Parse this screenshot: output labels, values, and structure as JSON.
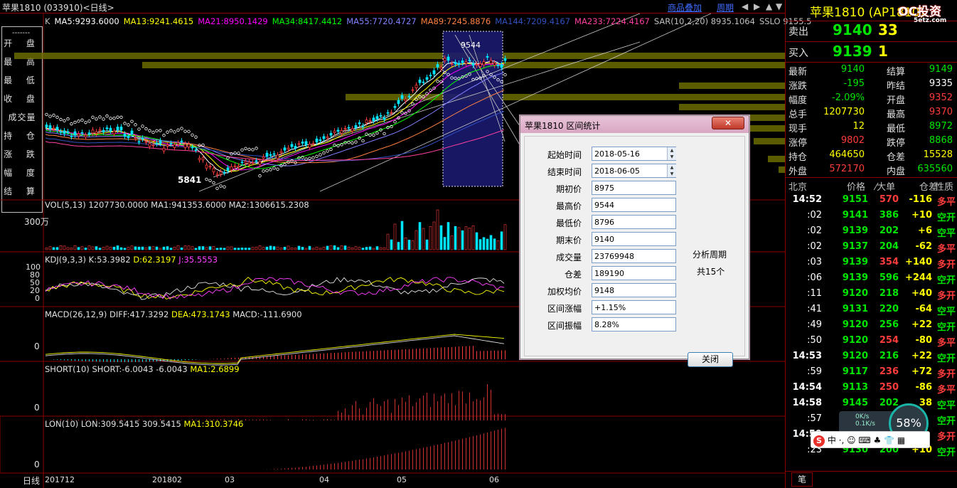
{
  "title": "苹果1810 (033910)<日线>",
  "toplinks": [
    "商品叠加",
    "周期"
  ],
  "left_panel": [
    "开 盘",
    "最 高",
    "最 低",
    "收 盘",
    "成交量",
    "持 仓",
    "涨 跌",
    "幅 度",
    "结 算"
  ],
  "main_chart": {
    "indicators": [
      {
        "text": "K",
        "color": "#c0c0c0"
      },
      {
        "text": "MA5:9293.6000",
        "color": "#ffffff"
      },
      {
        "text": "MA13:9241.4615",
        "color": "#ffff00"
      },
      {
        "text": "MA21:8950.1429",
        "color": "#ff00ff"
      },
      {
        "text": "MA34:8417.4412",
        "color": "#00ff00"
      },
      {
        "text": "MA55:7720.4727",
        "color": "#8080ff"
      },
      {
        "text": "MA89:7245.8876",
        "color": "#ff8040"
      },
      {
        "text": "MA144:7209.4167",
        "color": "#3050c0"
      },
      {
        "text": "MA233:7224.4167",
        "color": "#ff40a0"
      },
      {
        "text": "SAR(10,2,20) 8935.1064",
        "color": "#c0c0c0"
      },
      {
        "text": "SSLO 9155.5",
        "color": "#c0c0c0"
      }
    ],
    "low_label": "5841",
    "high_label": "9544"
  },
  "vol_panel": {
    "label": "VOL(5,13) 1207730.0000 MA1:941353.6000 MA2:1306615.2308",
    "axis": "300万"
  },
  "kdj_panel": {
    "label_a": "KDJ(9,3,3) K:53.3982",
    "label_b": "D:62.3197",
    "label_c": "J:35.5553",
    "axis": [
      "100",
      "80",
      "50",
      "20",
      "0"
    ]
  },
  "macd_panel": {
    "label_a": "MACD(26,12,9) DIFF:417.3292",
    "label_b": "DEA:473.1743",
    "label_c": "MACD:-111.6900",
    "axis": "0"
  },
  "short_panel": {
    "label_a": "SHORT(10) SHORT:-6.0043 -6.0043",
    "label_b": "MA1:2.6899",
    "axis": "0"
  },
  "lon_panel": {
    "label_a": "LON(10) LON:309.5415 309.5415",
    "label_b": "MA1:310.3746",
    "axis": "0"
  },
  "x_axis": {
    "period": "日线",
    "labels": [
      "201712",
      "201802",
      "03",
      "04",
      "05",
      "06"
    ]
  },
  "right_panel": {
    "name": "苹果1810 (AP1810)",
    "sell_label": "卖出",
    "sell_price": "9140",
    "sell_vol": "33",
    "buy_label": "买入",
    "buy_price": "9139",
    "buy_vol": "1",
    "quotes": [
      [
        "最新",
        "9140",
        "结算",
        "9149"
      ],
      [
        "涨跌",
        "-195",
        "昨结",
        "9335"
      ],
      [
        "幅度",
        "-2.09%",
        "开盘",
        "9352"
      ],
      [
        "总手",
        "1207730",
        "最高",
        "9370"
      ],
      [
        "现手",
        "12",
        "最低",
        "8972"
      ],
      [
        "涨停",
        "9802",
        "跌停",
        "8868"
      ],
      [
        "持仓",
        "464650",
        "仓差",
        "15528"
      ],
      [
        "外盘",
        "572170",
        "内盘",
        "635560"
      ]
    ],
    "ticks_header": [
      "北京",
      "价格",
      "⁄大单",
      "仓差",
      "性质"
    ],
    "ticks": [
      [
        "14:52",
        "9151",
        "570",
        "-116",
        "多平"
      ],
      [
        ":02",
        "9141",
        "386",
        "+10",
        "空开"
      ],
      [
        ":02",
        "9139",
        "202",
        "+6",
        "空平"
      ],
      [
        ":02",
        "9137",
        "204",
        "-62",
        "多平"
      ],
      [
        ":03",
        "9139",
        "354",
        "+140",
        "多开"
      ],
      [
        ":06",
        "9139",
        "596",
        "+244",
        "空开"
      ],
      [
        ":11",
        "9120",
        "218",
        "+40",
        "多开"
      ],
      [
        ":41",
        "9131",
        "220",
        "-64",
        "空平"
      ],
      [
        ":49",
        "9120",
        "256",
        "+22",
        "空开"
      ],
      [
        ":50",
        "9120",
        "254",
        "-80",
        "多平"
      ],
      [
        "14:53",
        "9120",
        "216",
        "+22",
        "空开"
      ],
      [
        ":59",
        "9117",
        "236",
        "+72",
        "多开"
      ],
      [
        "14:54",
        "9113",
        "250",
        "-86",
        "多平"
      ],
      [
        "14:58",
        "9145",
        "202",
        "38",
        "空平"
      ],
      [
        ":57",
        "91",
        "",
        "",
        "空开"
      ],
      [
        "14:59",
        "",
        "",
        "",
        "多开"
      ],
      [
        ":23",
        "9130",
        "200",
        "+10",
        "空开"
      ]
    ],
    "footer_tab": "笔"
  },
  "dialog": {
    "title": "苹果1810 区间统计",
    "close_symbol": "✕",
    "fields": [
      {
        "label": "起始时间",
        "value": "2018-05-16"
      },
      {
        "label": "结束时间",
        "value": "2018-06-05"
      },
      {
        "label": "期初价",
        "value": "8975"
      },
      {
        "label": "最高价",
        "value": "9544"
      },
      {
        "label": "最低价",
        "value": "8796"
      },
      {
        "label": "期末价",
        "value": "9140"
      },
      {
        "label": "成交量",
        "value": "23769948"
      },
      {
        "label": "仓差",
        "value": "189190"
      },
      {
        "label": "加权均价",
        "value": "9148"
      },
      {
        "label": "区间涨幅",
        "value": "+1.15%"
      },
      {
        "label": "区间振幅",
        "value": "8.28%"
      }
    ],
    "period_label": "分析周期",
    "period_value": "共15个",
    "close_button": "关闭"
  },
  "overlays": {
    "logo_text": "OC投资",
    "logo_sub": "5etz.com",
    "gauge": "58%",
    "speed_up": "0K/s",
    "speed_down": "0.1K/s",
    "ime": "中 ·, ☺ ⌨ ♣ 👕 ▦"
  }
}
